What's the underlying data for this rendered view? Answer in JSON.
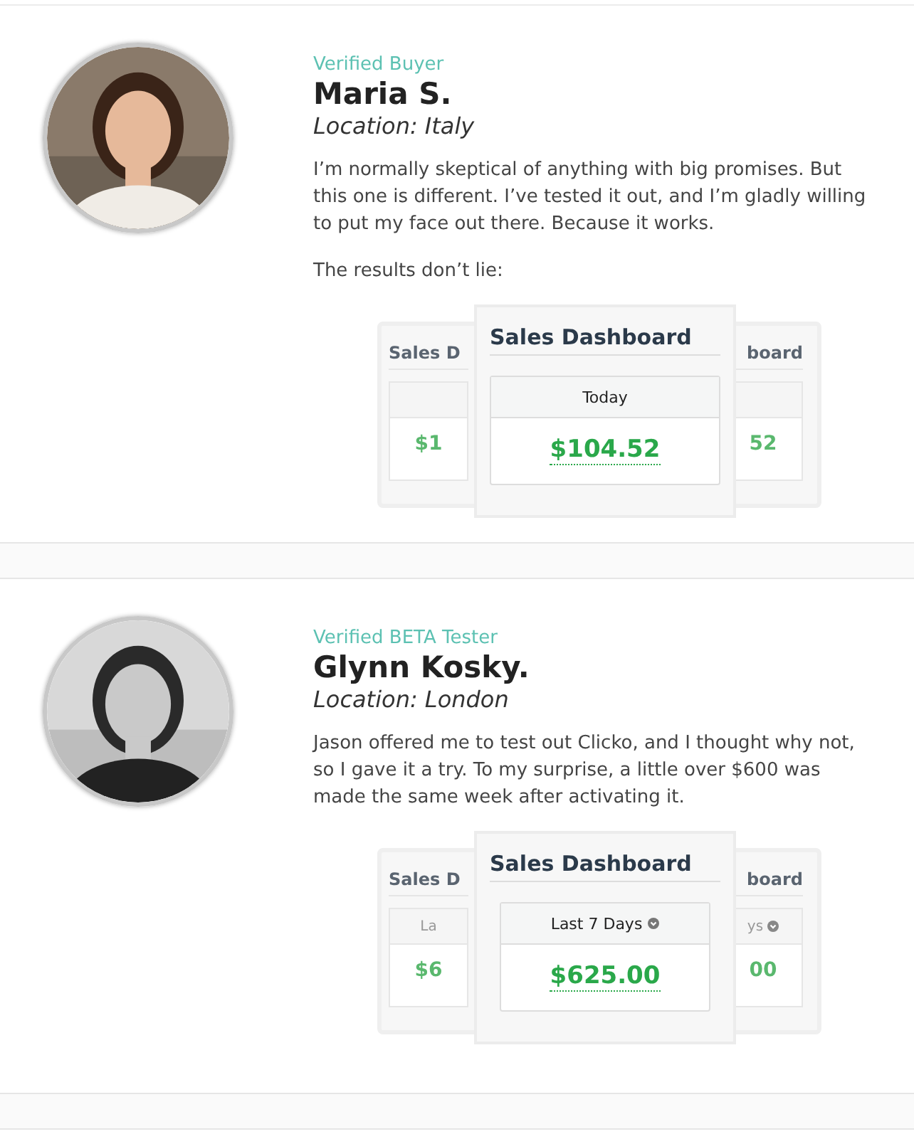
{
  "testimonials": [
    {
      "badge": "Verified Buyer",
      "name": "Maria S.",
      "location": "Location: Italy",
      "paragraphs": [
        "I’m normally skeptical of anything with big promises. But this one is different. I’ve tested it out, and I’m gladly willing to put my face out there. Because it works.",
        "The results don’t lie:"
      ],
      "dashboard": {
        "title": "Sales Dashboard",
        "period": "Today",
        "period_menu": false,
        "amount": "$104.52",
        "back_left": {
          "title": "Sales D",
          "amount": "$1"
        },
        "back_right": {
          "title": "board",
          "amount": "52"
        }
      }
    },
    {
      "badge": "Verified BETA Tester",
      "name": "Glynn Kosky.",
      "location": "Location: London",
      "paragraphs": [
        "Jason offered me to test out Clicko, and I thought why not, so I gave it a try. To my surprise, a little over $600 was made the same week after activating it."
      ],
      "dashboard": {
        "title": "Sales Dashboard",
        "period": "Last 7 Days",
        "period_menu": true,
        "amount": "$625.00",
        "back_left": {
          "title": "Sales D",
          "period": "La",
          "amount": "$6"
        },
        "back_right": {
          "title": "board",
          "period": "ys",
          "amount": "00"
        }
      }
    }
  ]
}
